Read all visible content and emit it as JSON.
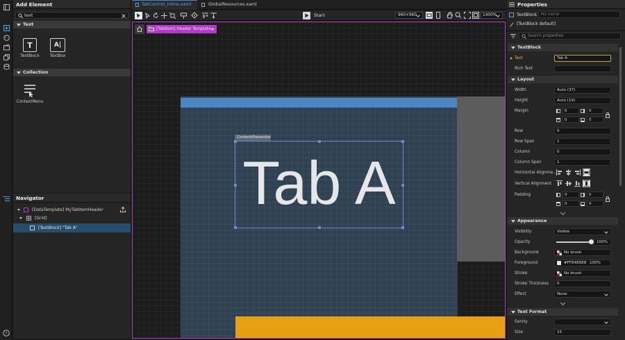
{
  "add_element": {
    "title": "Add Element",
    "search_value": "text",
    "sections": {
      "text": "Text",
      "collection": "Collection"
    },
    "tools": {
      "textblock": "TextBlock",
      "textbox": "TextBox",
      "contextmenu": "ContextMenu"
    }
  },
  "navigator": {
    "title": "Navigator",
    "items": [
      "[DataTemplate] MyTabItemHeader",
      "[Grid]",
      "[TextBlock] \"Tab A\""
    ]
  },
  "tabs": [
    {
      "label": "TabControl_Inline.xaml",
      "active": true
    },
    {
      "label": "GlobalResources.xaml",
      "active": false
    }
  ],
  "toolbar": {
    "start_label": "Start",
    "size_select": "960×960",
    "zoom": "1400%"
  },
  "canvas": {
    "breadcrumb": "[TabItem] Header Template",
    "adorner_label": "ContentPresenter",
    "text_content": "Tab A"
  },
  "properties": {
    "title": "Properties",
    "element_type": "TextBlock",
    "name_placeholder": "No name",
    "style_value": "[TextBlock default]",
    "search_placeholder": "Search properties",
    "sections": {
      "textblock": "TextBlock",
      "layout": "Layout",
      "appearance": "Appearance",
      "text_format": "Text Format"
    },
    "text": {
      "label": "Text",
      "value": "Tab A"
    },
    "rich_text": {
      "label": "Rich Text",
      "value": ""
    },
    "width": {
      "label": "Width",
      "value": "Auto (37)"
    },
    "height": {
      "label": "Height",
      "value": "Auto (19)"
    },
    "margin": {
      "label": "Margin",
      "values": [
        "0",
        "0",
        "0",
        "0"
      ]
    },
    "row": {
      "label": "Row",
      "value": "0"
    },
    "row_span": {
      "label": "Row Span",
      "value": "1"
    },
    "column": {
      "label": "Column",
      "value": "0"
    },
    "column_span": {
      "label": "Column Span",
      "value": "1"
    },
    "horizontal_alignment": {
      "label": "Horizontal Alignme..."
    },
    "vertical_alignment": {
      "label": "Vertical Alignment"
    },
    "padding": {
      "label": "Padding",
      "values": [
        "0",
        "0",
        "0",
        "0"
      ]
    },
    "visibility": {
      "label": "Visibility",
      "value": "Visible"
    },
    "opacity": {
      "label": "Opacity",
      "value": "100%",
      "level": 1.0
    },
    "background": {
      "label": "Background",
      "value": "No brush"
    },
    "foreground": {
      "label": "Foreground",
      "value": "#FFE4E6E8",
      "opacity": "100%"
    },
    "stroke": {
      "label": "Stroke",
      "value": "No brush"
    },
    "stroke_thickness": {
      "label": "Stroke Thickness",
      "value": "0"
    },
    "effect": {
      "label": "Effect",
      "value": "None"
    },
    "family": {
      "label": "Family",
      "value": ""
    },
    "size": {
      "label": "Size",
      "value": "15"
    }
  },
  "colors": {
    "accent_magenta": "#b23cc9",
    "selection_blue": "#6b8fc4",
    "header_blue": "#4a86c2",
    "orange": "#e8a013",
    "text_accent": "#e3b44c"
  }
}
